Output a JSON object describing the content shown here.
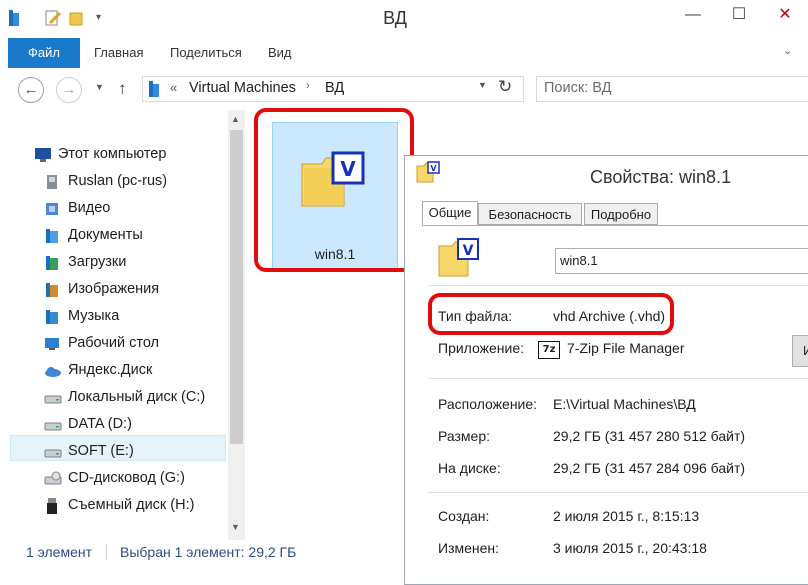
{
  "window": {
    "title": "ВД"
  },
  "ribbon": {
    "file": "Файл",
    "tabs": [
      "Главная",
      "Поделиться",
      "Вид"
    ]
  },
  "address": {
    "chevron": "«",
    "path": [
      "Virtual Machines",
      "ВД"
    ],
    "refresh_icon": "refresh-icon"
  },
  "search": {
    "placeholder": "Поиск: ВД"
  },
  "nav": {
    "items": [
      {
        "label": "Этот компьютер",
        "icon": "computer-icon"
      },
      {
        "label": "Ruslan (pc-rus)",
        "icon": "user-icon"
      },
      {
        "label": "Видео",
        "icon": "video-icon"
      },
      {
        "label": "Документы",
        "icon": "documents-icon"
      },
      {
        "label": "Загрузки",
        "icon": "downloads-icon"
      },
      {
        "label": "Изображения",
        "icon": "pictures-icon"
      },
      {
        "label": "Музыка",
        "icon": "music-icon"
      },
      {
        "label": "Рабочий стол",
        "icon": "desktop-icon"
      },
      {
        "label": "Яндекс.Диск",
        "icon": "cloud-icon"
      },
      {
        "label": "Локальный диск (C:)",
        "icon": "drive-icon"
      },
      {
        "label": "DATA (D:)",
        "icon": "drive-icon"
      },
      {
        "label": "SOFT (E:)",
        "icon": "drive-icon"
      },
      {
        "label": "CD-дисковод (G:)",
        "icon": "cd-drive-icon"
      },
      {
        "label": "Съемный диск (H:)",
        "icon": "usb-drive-icon"
      }
    ],
    "selected_index": 11
  },
  "content": {
    "file_name": "win8.1"
  },
  "status": {
    "count": "1 элемент",
    "selection": "Выбран 1 элемент: 29,2 ГБ"
  },
  "properties": {
    "title": "Свойства: win8.1",
    "tabs": [
      "Общие",
      "Безопасность",
      "Подробно"
    ],
    "name_value": "win8.1",
    "type_label": "Тип файла:",
    "type_value": "vhd Archive (.vhd)",
    "app_label": "Приложение:",
    "app_value": "7-Zip File Manager",
    "app_icon_text": "7z",
    "change_button": "И",
    "location_label": "Расположение:",
    "location_value": "E:\\Virtual Machines\\ВД",
    "size_label": "Размер:",
    "size_value": "29,2 ГБ (31 457 280 512 байт)",
    "disk_label": "На диске:",
    "disk_value": "29,2 ГБ (31 457 284 096 байт)",
    "created_label": "Создан:",
    "created_value": "2 июля 2015 г., 8:15:13",
    "modified_label": "Изменен:",
    "modified_value": "3 июля 2015 г., 20:43:18"
  },
  "colors": {
    "accent": "#1979ca",
    "highlight": "#e30c0c",
    "selection": "#cce8ff"
  }
}
